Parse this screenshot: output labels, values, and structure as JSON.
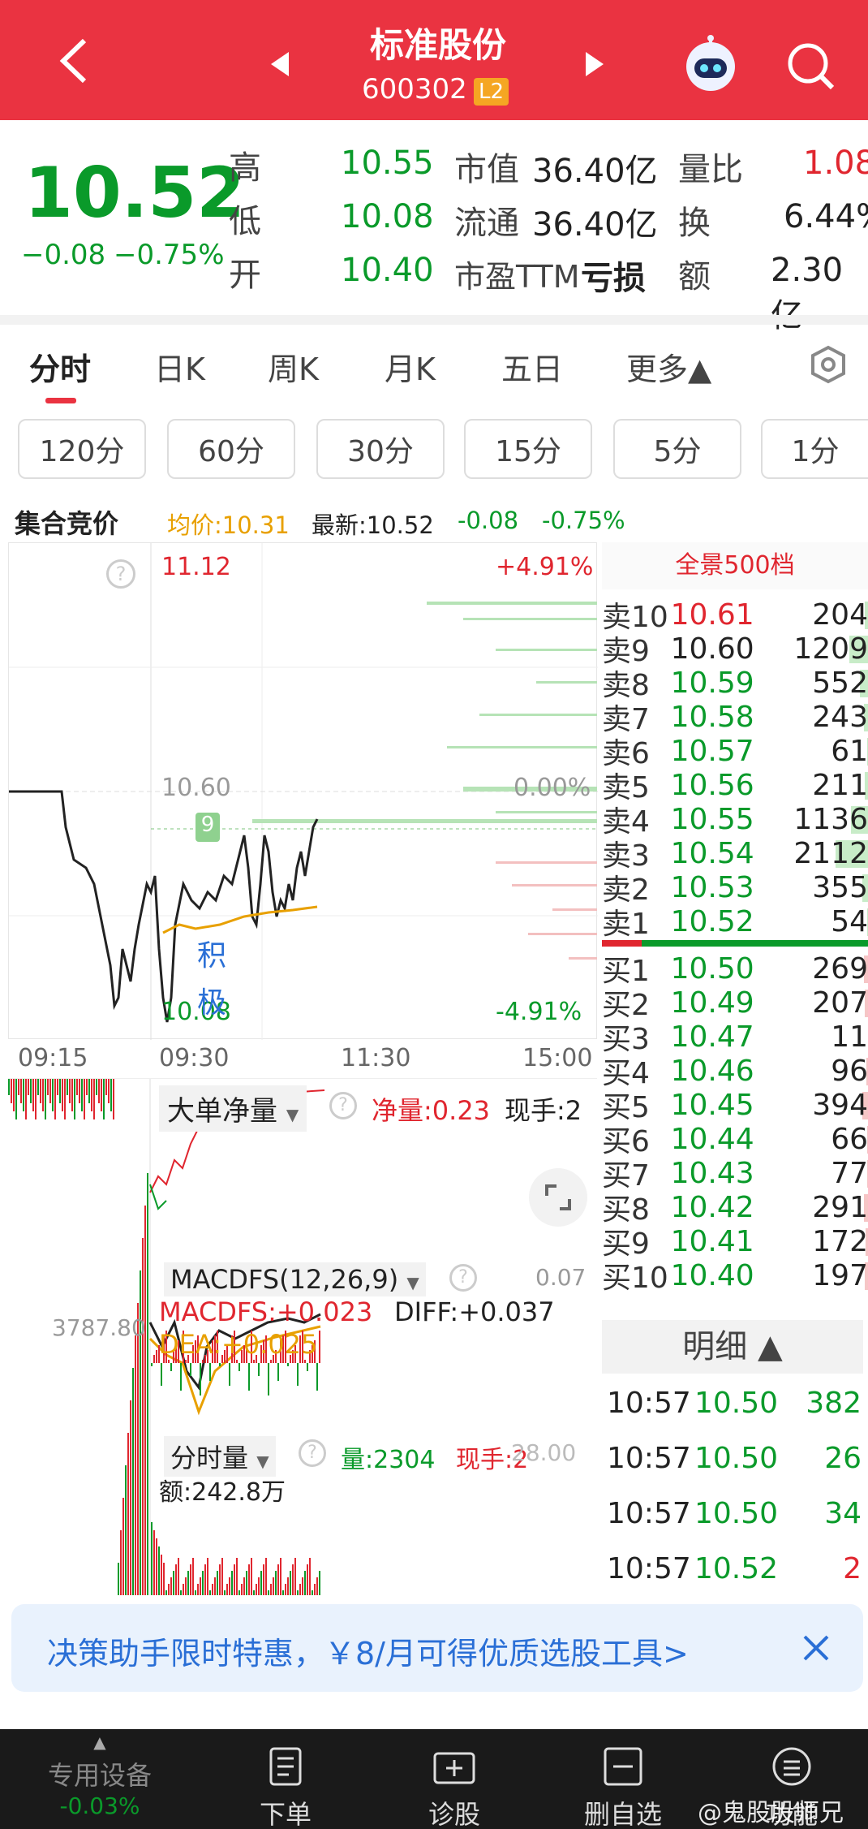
{
  "header": {
    "title": "标准股份",
    "code": "600302",
    "badge": "L2"
  },
  "quote": {
    "price": "10.52",
    "change": "−0.08",
    "change_pct": "−0.75%",
    "high_label": "高",
    "high": "10.55",
    "low_label": "低",
    "low": "10.08",
    "open_label": "开",
    "open": "10.40",
    "mcap_label": "市值",
    "mcap": "36.40亿",
    "float_label": "流通",
    "float": "36.40亿",
    "pe_label": "市盈TTM",
    "pe": "亏损",
    "vr_label": "量比",
    "vr": "1.08",
    "turn_label": "换",
    "turn": "6.44%",
    "amt_label": "额",
    "amt": "2.30亿"
  },
  "tabs": [
    "分时",
    "日K",
    "周K",
    "月K",
    "五日",
    "更多▲"
  ],
  "periods": [
    "120分",
    "60分",
    "30分",
    "15分",
    "5分",
    "1分"
  ],
  "auction_bar": {
    "title": "集合竞价",
    "avg": "均价:10.31",
    "latest": "最新:10.52",
    "chg": "-0.08",
    "chg_pct": "-0.75%"
  },
  "chart": {
    "price_high": "11.12",
    "pct_high": "+4.91%",
    "price_mid": "10.60",
    "pct_mid": "0.00%",
    "price_low": "10.08",
    "pct_low": "-4.91%",
    "marker": "9",
    "annot": "积极",
    "times": [
      "09:15",
      "09:30",
      "11:30",
      "15:00"
    ]
  },
  "orderbook": {
    "title": "全景500档",
    "asks": [
      {
        "label": "卖10",
        "price": "10.61",
        "vol": "204"
      },
      {
        "label": "卖9",
        "price": "10.60",
        "vol": "1209"
      },
      {
        "label": "卖8",
        "price": "10.59",
        "vol": "552"
      },
      {
        "label": "卖7",
        "price": "10.58",
        "vol": "243"
      },
      {
        "label": "卖6",
        "price": "10.57",
        "vol": "61"
      },
      {
        "label": "卖5",
        "price": "10.56",
        "vol": "211"
      },
      {
        "label": "卖4",
        "price": "10.55",
        "vol": "1136"
      },
      {
        "label": "卖3",
        "price": "10.54",
        "vol": "2112"
      },
      {
        "label": "卖2",
        "price": "10.53",
        "vol": "355"
      },
      {
        "label": "卖1",
        "price": "10.52",
        "vol": "54"
      }
    ],
    "bids": [
      {
        "label": "买1",
        "price": "10.50",
        "vol": "269"
      },
      {
        "label": "买2",
        "price": "10.49",
        "vol": "207"
      },
      {
        "label": "买3",
        "price": "10.47",
        "vol": "11"
      },
      {
        "label": "买4",
        "price": "10.46",
        "vol": "96"
      },
      {
        "label": "买5",
        "price": "10.45",
        "vol": "394"
      },
      {
        "label": "买6",
        "price": "10.44",
        "vol": "66"
      },
      {
        "label": "买7",
        "price": "10.43",
        "vol": "77"
      },
      {
        "label": "买8",
        "price": "10.42",
        "vol": "291"
      },
      {
        "label": "买9",
        "price": "10.41",
        "vol": "172"
      },
      {
        "label": "买10",
        "price": "10.40",
        "vol": "197"
      }
    ]
  },
  "detail": {
    "title": "明细 ▲",
    "rows": [
      {
        "time": "10:57",
        "price": "10.50",
        "vol": "382"
      },
      {
        "time": "10:57",
        "price": "10.50",
        "vol": "26"
      },
      {
        "time": "10:57",
        "price": "10.50",
        "vol": "34"
      },
      {
        "time": "10:57",
        "price": "10.52",
        "vol": "2"
      }
    ]
  },
  "panels": {
    "big": {
      "name": "大单净量",
      "net": "净量:0.23",
      "now": "现手:2"
    },
    "macd": {
      "name": "MACDFS(12,26,9)",
      "val": "0.07",
      "macd": "MACDFS:+0.023",
      "diff": "DIFF:+0.037",
      "dea": "DEA:+0.025"
    },
    "vol": {
      "name": "分时量",
      "vol": "量:2304",
      "now": "现手:2",
      "max": "28.00",
      "amt": "额:242.8万"
    },
    "left_value": "3787.80"
  },
  "banner": {
    "text": "决策助手限时特惠，￥8/月可得优质选股工具>"
  },
  "nav": {
    "device": "专用设备",
    "device_chg": "-0.03%",
    "order": "下单",
    "diag": "诊股",
    "remove": "删自选",
    "func": "功能"
  },
  "watermark": "@鬼股股师兄",
  "colors": {
    "header": "#ea3341",
    "up": "#e0262f",
    "down": "#0a9a2a",
    "avg": "#e8a000"
  }
}
